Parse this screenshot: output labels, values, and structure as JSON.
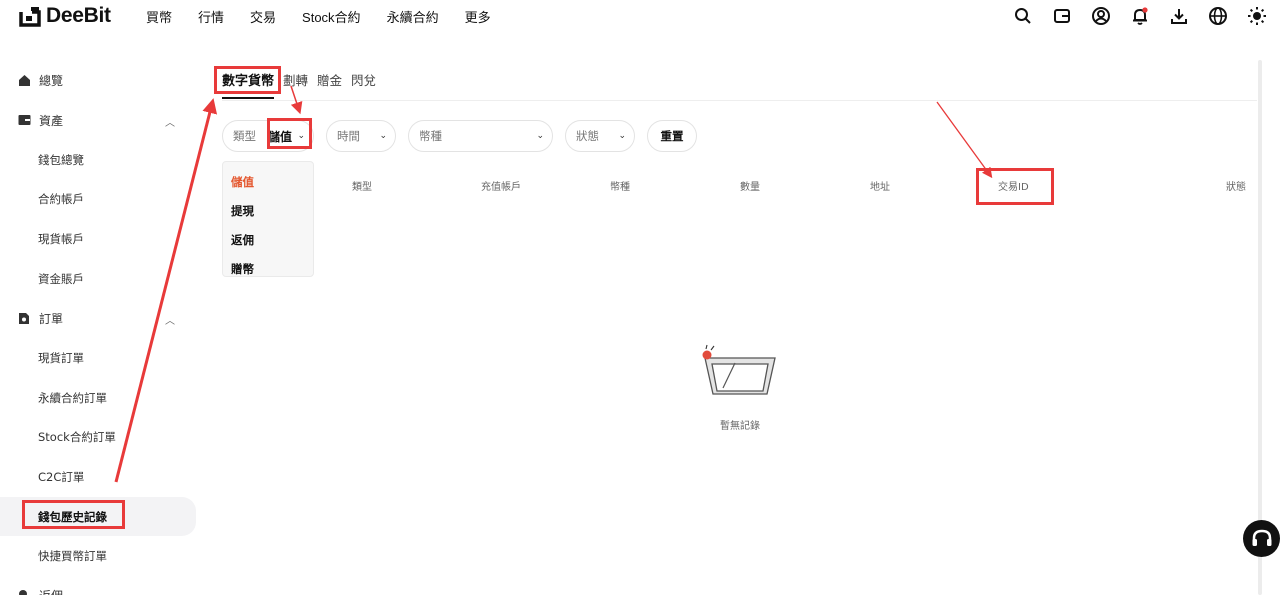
{
  "brand": {
    "name": "DeeBit"
  },
  "nav": {
    "items": [
      "買幣",
      "行情",
      "交易",
      "Stock合約",
      "永續合約",
      "更多"
    ]
  },
  "topicons": [
    "search-icon",
    "wallet-icon",
    "user-icon",
    "bell-icon",
    "download-icon",
    "globe-icon",
    "sun-icon"
  ],
  "sidebar": {
    "overview": "總覽",
    "assets": "資產",
    "wallet_overview": "錢包總覽",
    "contract_account": "合約帳戶",
    "spot_account": "現貨帳戶",
    "funding_account": "資金賬戶",
    "orders": "訂單",
    "spot_orders": "現貨訂單",
    "perp_orders": "永續合約訂單",
    "stock_orders": "Stock合約訂單",
    "c2c_orders": "C2C訂單",
    "wallet_history": "錢包歷史記錄",
    "quick_buy_orders": "快捷買幣訂單",
    "rebate": "返佣"
  },
  "tabs": {
    "digital": "數字貨幣",
    "transfer": "劃轉",
    "bonus": "贈金",
    "flash": "閃兌"
  },
  "filters": {
    "type_label": "類型",
    "type_value": "儲值",
    "time": "時間",
    "coin": "幣種",
    "status": "狀態",
    "reset": "重置"
  },
  "dropdown": {
    "options": [
      "儲值",
      "提現",
      "返佣",
      "贈幣"
    ],
    "selected": "儲值"
  },
  "table": {
    "headers": [
      "類型",
      "充值帳戶",
      "幣種",
      "數量",
      "地址",
      "交易ID",
      "狀態"
    ]
  },
  "empty": {
    "text": "暫無記錄"
  },
  "colors": {
    "accent": "#e4572e",
    "annotation": "#e83a3a"
  }
}
